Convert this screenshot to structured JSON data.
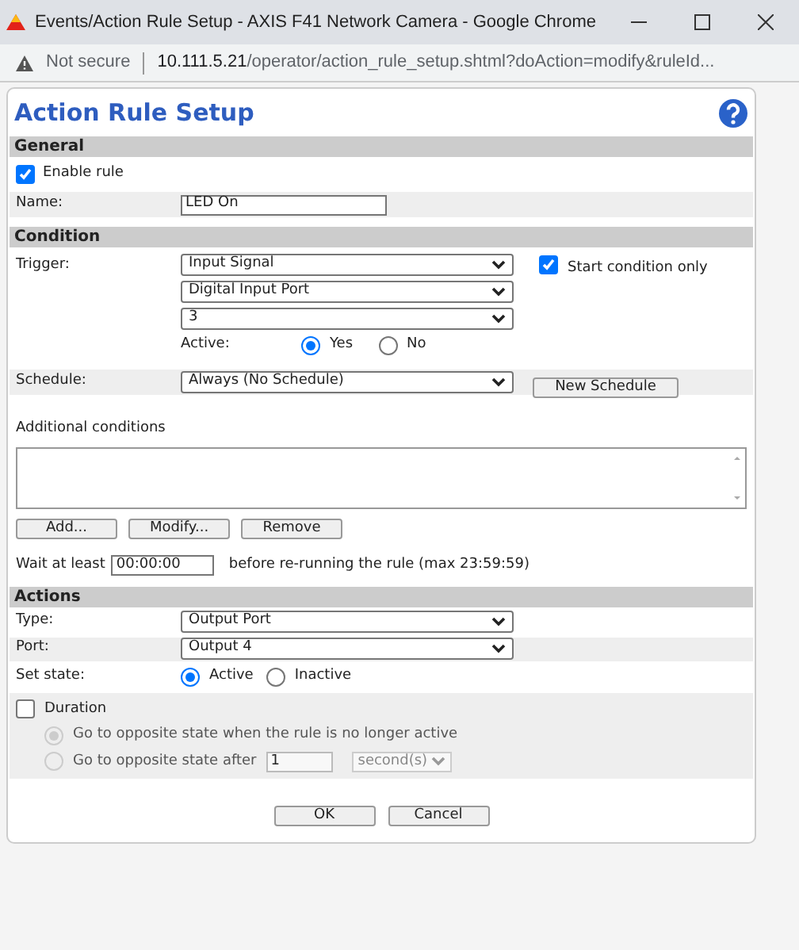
{
  "window": {
    "title": "Events/Action Rule Setup - AXIS F41 Network Camera - Google Chrome"
  },
  "address_bar": {
    "security": "Not secure",
    "url_host": "10.111.5.21",
    "url_path": "/operator/action_rule_setup.shtml?doAction=modify&ruleId..."
  },
  "page": {
    "title": "Action Rule Setup"
  },
  "general": {
    "title": "General",
    "enable_rule": {
      "label": "Enable rule",
      "checked": true
    },
    "name": {
      "label": "Name:",
      "value": "LED On"
    }
  },
  "condition": {
    "title": "Condition",
    "trigger": {
      "label": "Trigger:",
      "selects": [
        "Input Signal",
        "Digital Input Port",
        "3"
      ],
      "start_only": {
        "label": "Start condition only",
        "checked": true
      },
      "active": {
        "label": "Active:",
        "options": [
          {
            "label": "Yes",
            "selected": true
          },
          {
            "label": "No",
            "selected": false
          }
        ]
      }
    },
    "schedule": {
      "label": "Schedule:",
      "value": "Always (No Schedule)",
      "button": "New Schedule"
    },
    "additional": {
      "label": "Additional conditions",
      "buttons": [
        "Add...",
        "Modify...",
        "Remove"
      ]
    },
    "wait": {
      "label": "Wait at least",
      "value": "00:00:00",
      "suffix": "before re-running the rule (max 23:59:59)"
    }
  },
  "actions": {
    "title": "Actions",
    "type": {
      "label": "Type:",
      "value": "Output Port"
    },
    "port": {
      "label": "Port:",
      "value": "Output 4"
    },
    "set_state": {
      "label": "Set state:",
      "options": [
        {
          "label": "Active",
          "selected": true
        },
        {
          "label": "Inactive",
          "selected": false
        }
      ]
    },
    "duration": {
      "label": "Duration",
      "checked": false,
      "options": [
        {
          "label": "Go to opposite state when the rule is no longer active",
          "selected": true,
          "disabled": true
        },
        {
          "label": "Go to opposite state after",
          "selected": false,
          "disabled": true
        }
      ],
      "after_value": "1",
      "unit": "second(s)"
    }
  },
  "buttons": [
    "OK",
    "Cancel"
  ]
}
